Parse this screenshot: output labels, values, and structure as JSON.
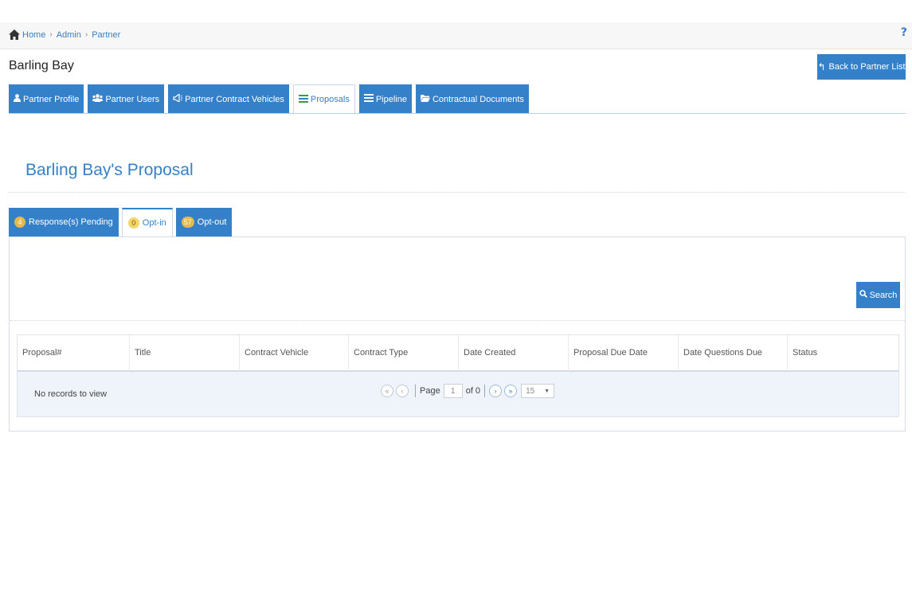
{
  "breadcrumb": {
    "items": [
      "Home",
      "Admin",
      "Partner"
    ],
    "separator": "›"
  },
  "help_label": "?",
  "partner_name": "Barling Bay",
  "back_button_label": "Back to Partner List",
  "main_tabs": [
    {
      "label": "Partner Profile",
      "icon": "user-icon",
      "active": false
    },
    {
      "label": "Partner Users",
      "icon": "users-icon",
      "active": false
    },
    {
      "label": "Partner Contract Vehicles",
      "icon": "megaphone-icon",
      "active": false
    },
    {
      "label": "Proposals",
      "icon": "tasks-icon",
      "active": true
    },
    {
      "label": "Pipeline",
      "icon": "tasks-icon",
      "active": false
    },
    {
      "label": "Contractual Documents",
      "icon": "folder-icon",
      "active": false
    }
  ],
  "section_title": "Barling Bay's Proposal",
  "sub_tabs": [
    {
      "count": "4",
      "label": "Response(s) Pending",
      "active": false
    },
    {
      "count": "0",
      "label": "Opt-in",
      "active": true
    },
    {
      "count": "57",
      "label": "Opt-out",
      "active": false
    }
  ],
  "search_button_label": "Search",
  "grid": {
    "columns": [
      "Proposal#",
      "Title",
      "Contract Vehicle",
      "Contract Type",
      "Date Created",
      "Proposal Due Date",
      "Date Questions Due",
      "Status"
    ],
    "empty_text": "No records to view"
  },
  "pager": {
    "page_label": "Page",
    "page_value": "1",
    "of_label": "of 0",
    "rows_per_page": "15"
  },
  "colors": {
    "accent": "#3581c9",
    "badge": "#e5b94a"
  }
}
